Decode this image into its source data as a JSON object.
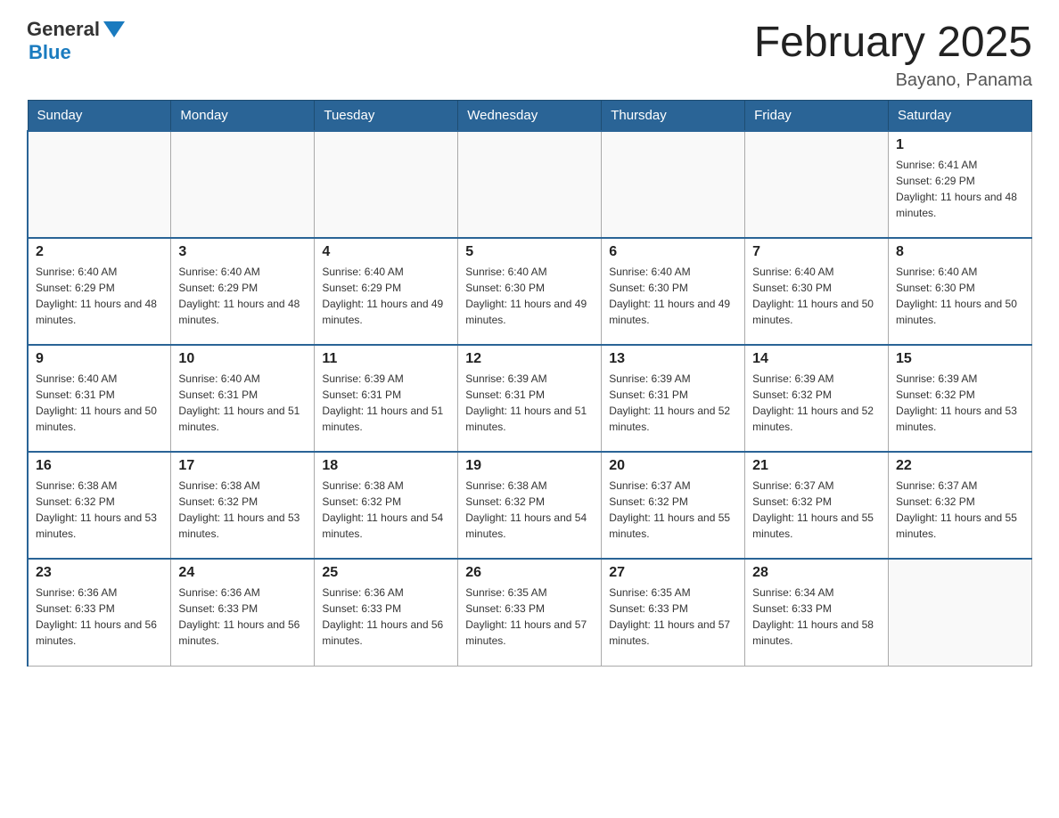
{
  "logo": {
    "general": "General",
    "blue": "Blue"
  },
  "title": "February 2025",
  "location": "Bayano, Panama",
  "days_of_week": [
    "Sunday",
    "Monday",
    "Tuesday",
    "Wednesday",
    "Thursday",
    "Friday",
    "Saturday"
  ],
  "weeks": [
    [
      {
        "day": "",
        "info": ""
      },
      {
        "day": "",
        "info": ""
      },
      {
        "day": "",
        "info": ""
      },
      {
        "day": "",
        "info": ""
      },
      {
        "day": "",
        "info": ""
      },
      {
        "day": "",
        "info": ""
      },
      {
        "day": "1",
        "info": "Sunrise: 6:41 AM\nSunset: 6:29 PM\nDaylight: 11 hours and 48 minutes."
      }
    ],
    [
      {
        "day": "2",
        "info": "Sunrise: 6:40 AM\nSunset: 6:29 PM\nDaylight: 11 hours and 48 minutes."
      },
      {
        "day": "3",
        "info": "Sunrise: 6:40 AM\nSunset: 6:29 PM\nDaylight: 11 hours and 48 minutes."
      },
      {
        "day": "4",
        "info": "Sunrise: 6:40 AM\nSunset: 6:29 PM\nDaylight: 11 hours and 49 minutes."
      },
      {
        "day": "5",
        "info": "Sunrise: 6:40 AM\nSunset: 6:30 PM\nDaylight: 11 hours and 49 minutes."
      },
      {
        "day": "6",
        "info": "Sunrise: 6:40 AM\nSunset: 6:30 PM\nDaylight: 11 hours and 49 minutes."
      },
      {
        "day": "7",
        "info": "Sunrise: 6:40 AM\nSunset: 6:30 PM\nDaylight: 11 hours and 50 minutes."
      },
      {
        "day": "8",
        "info": "Sunrise: 6:40 AM\nSunset: 6:30 PM\nDaylight: 11 hours and 50 minutes."
      }
    ],
    [
      {
        "day": "9",
        "info": "Sunrise: 6:40 AM\nSunset: 6:31 PM\nDaylight: 11 hours and 50 minutes."
      },
      {
        "day": "10",
        "info": "Sunrise: 6:40 AM\nSunset: 6:31 PM\nDaylight: 11 hours and 51 minutes."
      },
      {
        "day": "11",
        "info": "Sunrise: 6:39 AM\nSunset: 6:31 PM\nDaylight: 11 hours and 51 minutes."
      },
      {
        "day": "12",
        "info": "Sunrise: 6:39 AM\nSunset: 6:31 PM\nDaylight: 11 hours and 51 minutes."
      },
      {
        "day": "13",
        "info": "Sunrise: 6:39 AM\nSunset: 6:31 PM\nDaylight: 11 hours and 52 minutes."
      },
      {
        "day": "14",
        "info": "Sunrise: 6:39 AM\nSunset: 6:32 PM\nDaylight: 11 hours and 52 minutes."
      },
      {
        "day": "15",
        "info": "Sunrise: 6:39 AM\nSunset: 6:32 PM\nDaylight: 11 hours and 53 minutes."
      }
    ],
    [
      {
        "day": "16",
        "info": "Sunrise: 6:38 AM\nSunset: 6:32 PM\nDaylight: 11 hours and 53 minutes."
      },
      {
        "day": "17",
        "info": "Sunrise: 6:38 AM\nSunset: 6:32 PM\nDaylight: 11 hours and 53 minutes."
      },
      {
        "day": "18",
        "info": "Sunrise: 6:38 AM\nSunset: 6:32 PM\nDaylight: 11 hours and 54 minutes."
      },
      {
        "day": "19",
        "info": "Sunrise: 6:38 AM\nSunset: 6:32 PM\nDaylight: 11 hours and 54 minutes."
      },
      {
        "day": "20",
        "info": "Sunrise: 6:37 AM\nSunset: 6:32 PM\nDaylight: 11 hours and 55 minutes."
      },
      {
        "day": "21",
        "info": "Sunrise: 6:37 AM\nSunset: 6:32 PM\nDaylight: 11 hours and 55 minutes."
      },
      {
        "day": "22",
        "info": "Sunrise: 6:37 AM\nSunset: 6:32 PM\nDaylight: 11 hours and 55 minutes."
      }
    ],
    [
      {
        "day": "23",
        "info": "Sunrise: 6:36 AM\nSunset: 6:33 PM\nDaylight: 11 hours and 56 minutes."
      },
      {
        "day": "24",
        "info": "Sunrise: 6:36 AM\nSunset: 6:33 PM\nDaylight: 11 hours and 56 minutes."
      },
      {
        "day": "25",
        "info": "Sunrise: 6:36 AM\nSunset: 6:33 PM\nDaylight: 11 hours and 56 minutes."
      },
      {
        "day": "26",
        "info": "Sunrise: 6:35 AM\nSunset: 6:33 PM\nDaylight: 11 hours and 57 minutes."
      },
      {
        "day": "27",
        "info": "Sunrise: 6:35 AM\nSunset: 6:33 PM\nDaylight: 11 hours and 57 minutes."
      },
      {
        "day": "28",
        "info": "Sunrise: 6:34 AM\nSunset: 6:33 PM\nDaylight: 11 hours and 58 minutes."
      },
      {
        "day": "",
        "info": ""
      }
    ]
  ]
}
